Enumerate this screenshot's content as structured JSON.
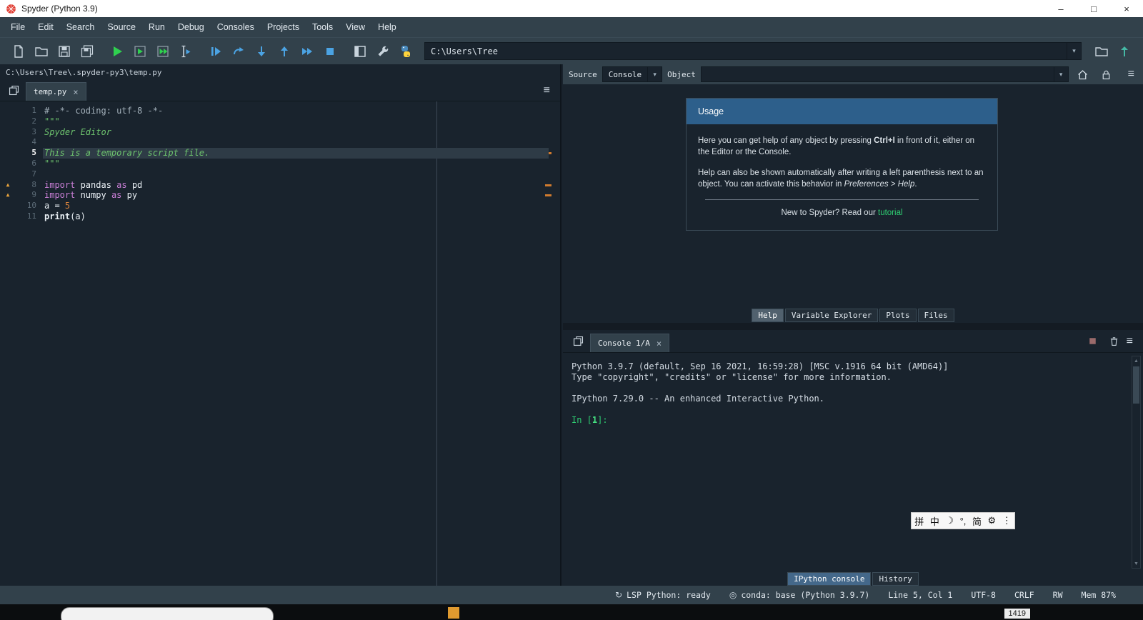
{
  "titlebar": {
    "title": "Spyder (Python 3.9)"
  },
  "menubar": [
    "File",
    "Edit",
    "Search",
    "Source",
    "Run",
    "Debug",
    "Consoles",
    "Projects",
    "Tools",
    "View",
    "Help"
  ],
  "toolbar": {
    "path": "C:\\Users\\Tree"
  },
  "editor": {
    "breadcrumb": "C:\\Users\\Tree\\.spyder-py3\\temp.py",
    "tab_label": "temp.py",
    "lines": [
      {
        "num": 1,
        "warn": false,
        "current": false,
        "marker": false,
        "tokens": [
          {
            "text": "# -*- coding: utf-8 -*-",
            "cls": "comment"
          }
        ]
      },
      {
        "num": 2,
        "warn": false,
        "current": false,
        "marker": false,
        "tokens": [
          {
            "text": "\"\"\"",
            "cls": "string"
          }
        ]
      },
      {
        "num": 3,
        "warn": false,
        "current": false,
        "marker": false,
        "tokens": [
          {
            "text": "Spyder Editor",
            "cls": "string"
          }
        ]
      },
      {
        "num": 4,
        "warn": false,
        "current": false,
        "marker": false,
        "tokens": []
      },
      {
        "num": 5,
        "warn": false,
        "current": true,
        "marker": true,
        "tokens": [
          {
            "text": "This is a temporary script file.",
            "cls": "string"
          }
        ]
      },
      {
        "num": 6,
        "warn": false,
        "current": false,
        "marker": false,
        "tokens": [
          {
            "text": "\"\"\"",
            "cls": "string"
          }
        ]
      },
      {
        "num": 7,
        "warn": false,
        "current": false,
        "marker": false,
        "tokens": []
      },
      {
        "num": 8,
        "warn": true,
        "current": false,
        "marker": true,
        "tokens": [
          {
            "text": "import",
            "cls": "kw"
          },
          {
            "text": " pandas ",
            "cls": "plain"
          },
          {
            "text": "as",
            "cls": "kw"
          },
          {
            "text": " pd",
            "cls": "plain"
          }
        ]
      },
      {
        "num": 9,
        "warn": true,
        "current": false,
        "marker": true,
        "tokens": [
          {
            "text": "import",
            "cls": "kw"
          },
          {
            "text": " numpy ",
            "cls": "plain"
          },
          {
            "text": "as",
            "cls": "kw"
          },
          {
            "text": " py",
            "cls": "plain"
          }
        ]
      },
      {
        "num": 10,
        "warn": false,
        "current": false,
        "marker": false,
        "tokens": [
          {
            "text": "a = ",
            "cls": "plain"
          },
          {
            "text": "5",
            "cls": "num"
          }
        ]
      },
      {
        "num": 11,
        "warn": false,
        "current": false,
        "marker": false,
        "tokens": [
          {
            "text": "print",
            "cls": "builtin"
          },
          {
            "text": "(a)",
            "cls": "plain"
          }
        ]
      }
    ]
  },
  "help": {
    "source_label": "Source",
    "source_value": "Console",
    "object_label": "Object",
    "object_value": "",
    "usage_title": "Usage",
    "p1_pre": "Here you can get help of any object by pressing ",
    "p1_key": "Ctrl+I",
    "p1_post": " in front of it, either on the Editor or the Console.",
    "p2_pre": "Help can also be shown automatically after writing a left parenthesis next to an object. You can activate this behavior in ",
    "p2_em": "Preferences > Help",
    "p2_post": ".",
    "footer_pre": "New to Spyder? Read our ",
    "footer_link": "tutorial",
    "tabs": [
      {
        "label": "Help",
        "active": true
      },
      {
        "label": "Variable Explorer",
        "active": false
      },
      {
        "label": "Plots",
        "active": false
      },
      {
        "label": "Files",
        "active": false
      }
    ]
  },
  "console": {
    "tab_label": "Console 1/A",
    "lines": [
      "Python 3.9.7 (default, Sep 16 2021, 16:59:28) [MSC v.1916 64 bit (AMD64)]",
      "Type \"copyright\", \"credits\" or \"license\" for more information.",
      "",
      "IPython 7.29.0 -- An enhanced Interactive Python.",
      ""
    ],
    "prompt_parts": [
      {
        "t": "In [",
        "c": "green"
      },
      {
        "t": "1",
        "c": "greenb"
      },
      {
        "t": "]: ",
        "c": "green"
      }
    ],
    "ime": [
      "拼",
      "中",
      "☽",
      "°,",
      "简",
      "⚙",
      "⋮"
    ],
    "bottom_tabs": [
      {
        "label": "IPython console",
        "active": true
      },
      {
        "label": "History",
        "active": false
      }
    ]
  },
  "statusbar": {
    "lsp": "LSP Python: ready",
    "conda": "conda: base (Python 3.9.7)",
    "cursor": "Line 5, Col 1",
    "encoding": "UTF-8",
    "eol": "CRLF",
    "rw": "RW",
    "mem": "Mem 87%"
  },
  "taskbar": {
    "clock": "1419"
  },
  "icons": {
    "hamburger": "≡",
    "close": "×",
    "dropdown": "▾",
    "warning": "▲",
    "minimize": "–",
    "maximize": "□",
    "window_close": "×",
    "scroll_up": "▲",
    "scroll_down": "▼",
    "lsp": "↻",
    "conda": "◎"
  },
  "colors": {
    "panel_bg": "#32414B",
    "editor_bg": "#19232D",
    "usage_header_blue": "#2d5f8b",
    "link_green": "#2ecc71",
    "warning_orange": "#e8a33d",
    "run_green": "#2fd04f",
    "debug_blue": "#4ba3e3",
    "cell_marker_orange": "#cf7a2e"
  }
}
